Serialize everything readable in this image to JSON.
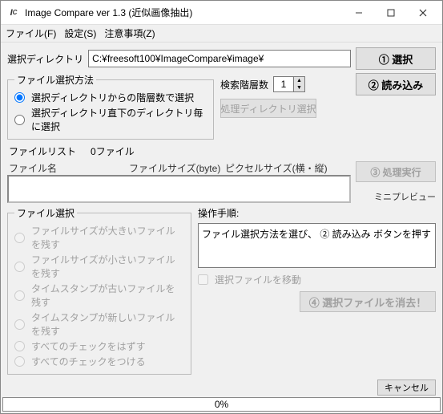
{
  "window": {
    "title": "Image Compare ver 1.3  (近似画像抽出)"
  },
  "menu": {
    "file": "ファイル(F)",
    "settings": "設定(S)",
    "notes": "注意事項(Z)"
  },
  "dirrow": {
    "label": "選択ディレクトリ",
    "value": "C:¥freesoft100¥ImageCompare¥image¥",
    "select_btn": "① 選択"
  },
  "method": {
    "legend": "ファイル選択方法",
    "opt1": "選択ディレクトリからの階層数で選択",
    "opt2": "選択ディレクトリ直下のディレクトリ毎に選択"
  },
  "search": {
    "label": "検索階層数",
    "value": "1",
    "procdir_btn": "処理ディレクトリ選択",
    "load_btn": "② 読み込み"
  },
  "filelist": {
    "label": "ファイルリスト",
    "count": "0ファイル",
    "col_name": "ファイル名",
    "col_size": "ファイルサイズ(byte)",
    "col_pixel": "ピクセルサイズ(横・縦)",
    "exec_btn": "③ 処理実行",
    "minipreview": "ミニプレビュー"
  },
  "fileselect": {
    "legend": "ファイル選択",
    "r1": "ファイルサイズが大きいファイルを残す",
    "r2": "ファイルサイズが小さいファイルを残す",
    "r3": "タイムスタンプが古いファイルを残す",
    "r4": "タイムスタンプが新しいファイルを残す",
    "r5": "すべてのチェックをはずす",
    "r6": "すべてのチェックをつける"
  },
  "ops": {
    "label": "操作手順:",
    "text": "ファイル選択方法を選び、 ② 読み込み ボタンを押す",
    "move_chk": "選択ファイルを移動",
    "delete_btn": "④ 選択ファイルを消去！"
  },
  "footer": {
    "cancel": "キャンセル"
  },
  "status": {
    "progress": "0%"
  }
}
